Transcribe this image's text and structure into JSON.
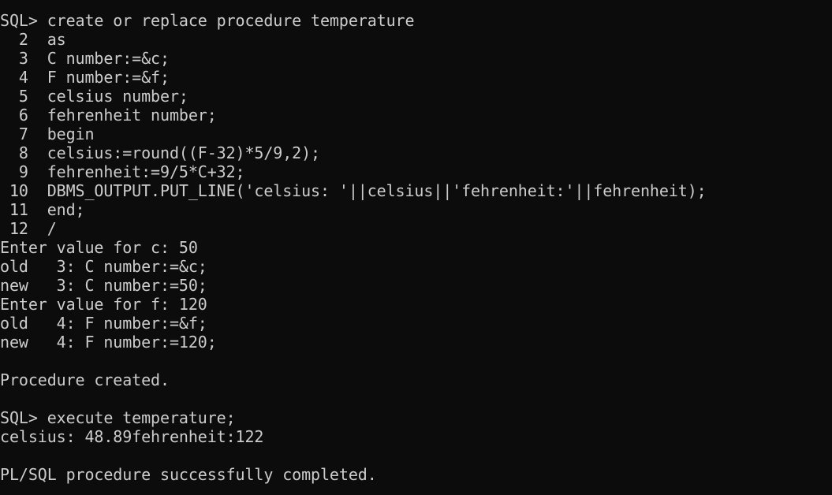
{
  "terminal": {
    "lines": [
      "SQL> create or replace procedure temperature",
      "  2  as",
      "  3  C number:=&c;",
      "  4  F number:=&f;",
      "  5  celsius number;",
      "  6  fehrenheit number;",
      "  7  begin",
      "  8  celsius:=round((F-32)*5/9,2);",
      "  9  fehrenheit:=9/5*C+32;",
      " 10  DBMS_OUTPUT.PUT_LINE('celsius: '||celsius||'fehrenheit:'||fehrenheit);",
      " 11  end;",
      " 12  /",
      "Enter value for c: 50",
      "old   3: C number:=&c;",
      "new   3: C number:=50;",
      "Enter value for f: 120",
      "old   4: F number:=&f;",
      "new   4: F number:=120;",
      "",
      "Procedure created.",
      "",
      "SQL> execute temperature;",
      "celsius: 48.89fehrenheit:122",
      "",
      "PL/SQL procedure successfully completed."
    ]
  }
}
